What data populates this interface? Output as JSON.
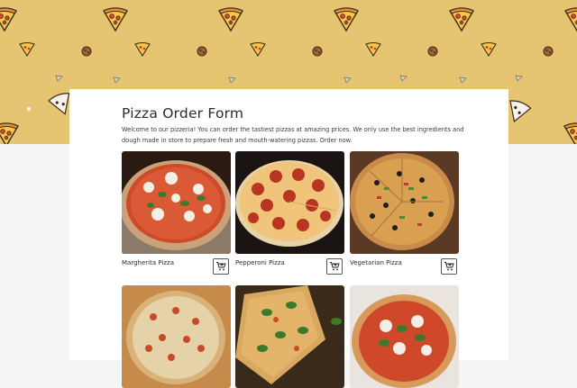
{
  "form": {
    "title": "Pizza Order Form",
    "intro": "Welcome to our pizzeria! You can order the tastiest pizzas at amazing prices. We only use the best ingredients and dough made in store to prepare fresh and mouth-watering pizzas. Order now."
  },
  "products": [
    {
      "name": "Margherita Pizza",
      "cart_icon": "add-to-cart-icon"
    },
    {
      "name": "Pepperoni Pizza",
      "cart_icon": "add-to-cart-icon"
    },
    {
      "name": "Vegetarian Pizza",
      "cart_icon": "add-to-cart-icon"
    },
    {
      "name": "",
      "cart_icon": "add-to-cart-icon"
    },
    {
      "name": "",
      "cart_icon": "add-to-cart-icon"
    },
    {
      "name": "",
      "cart_icon": "add-to-cart-icon"
    }
  ],
  "colors": {
    "hero_background": "#e5c572",
    "page_background": "#f5f5f5",
    "card_background": "#ffffff",
    "text": "#2b2b2b"
  }
}
